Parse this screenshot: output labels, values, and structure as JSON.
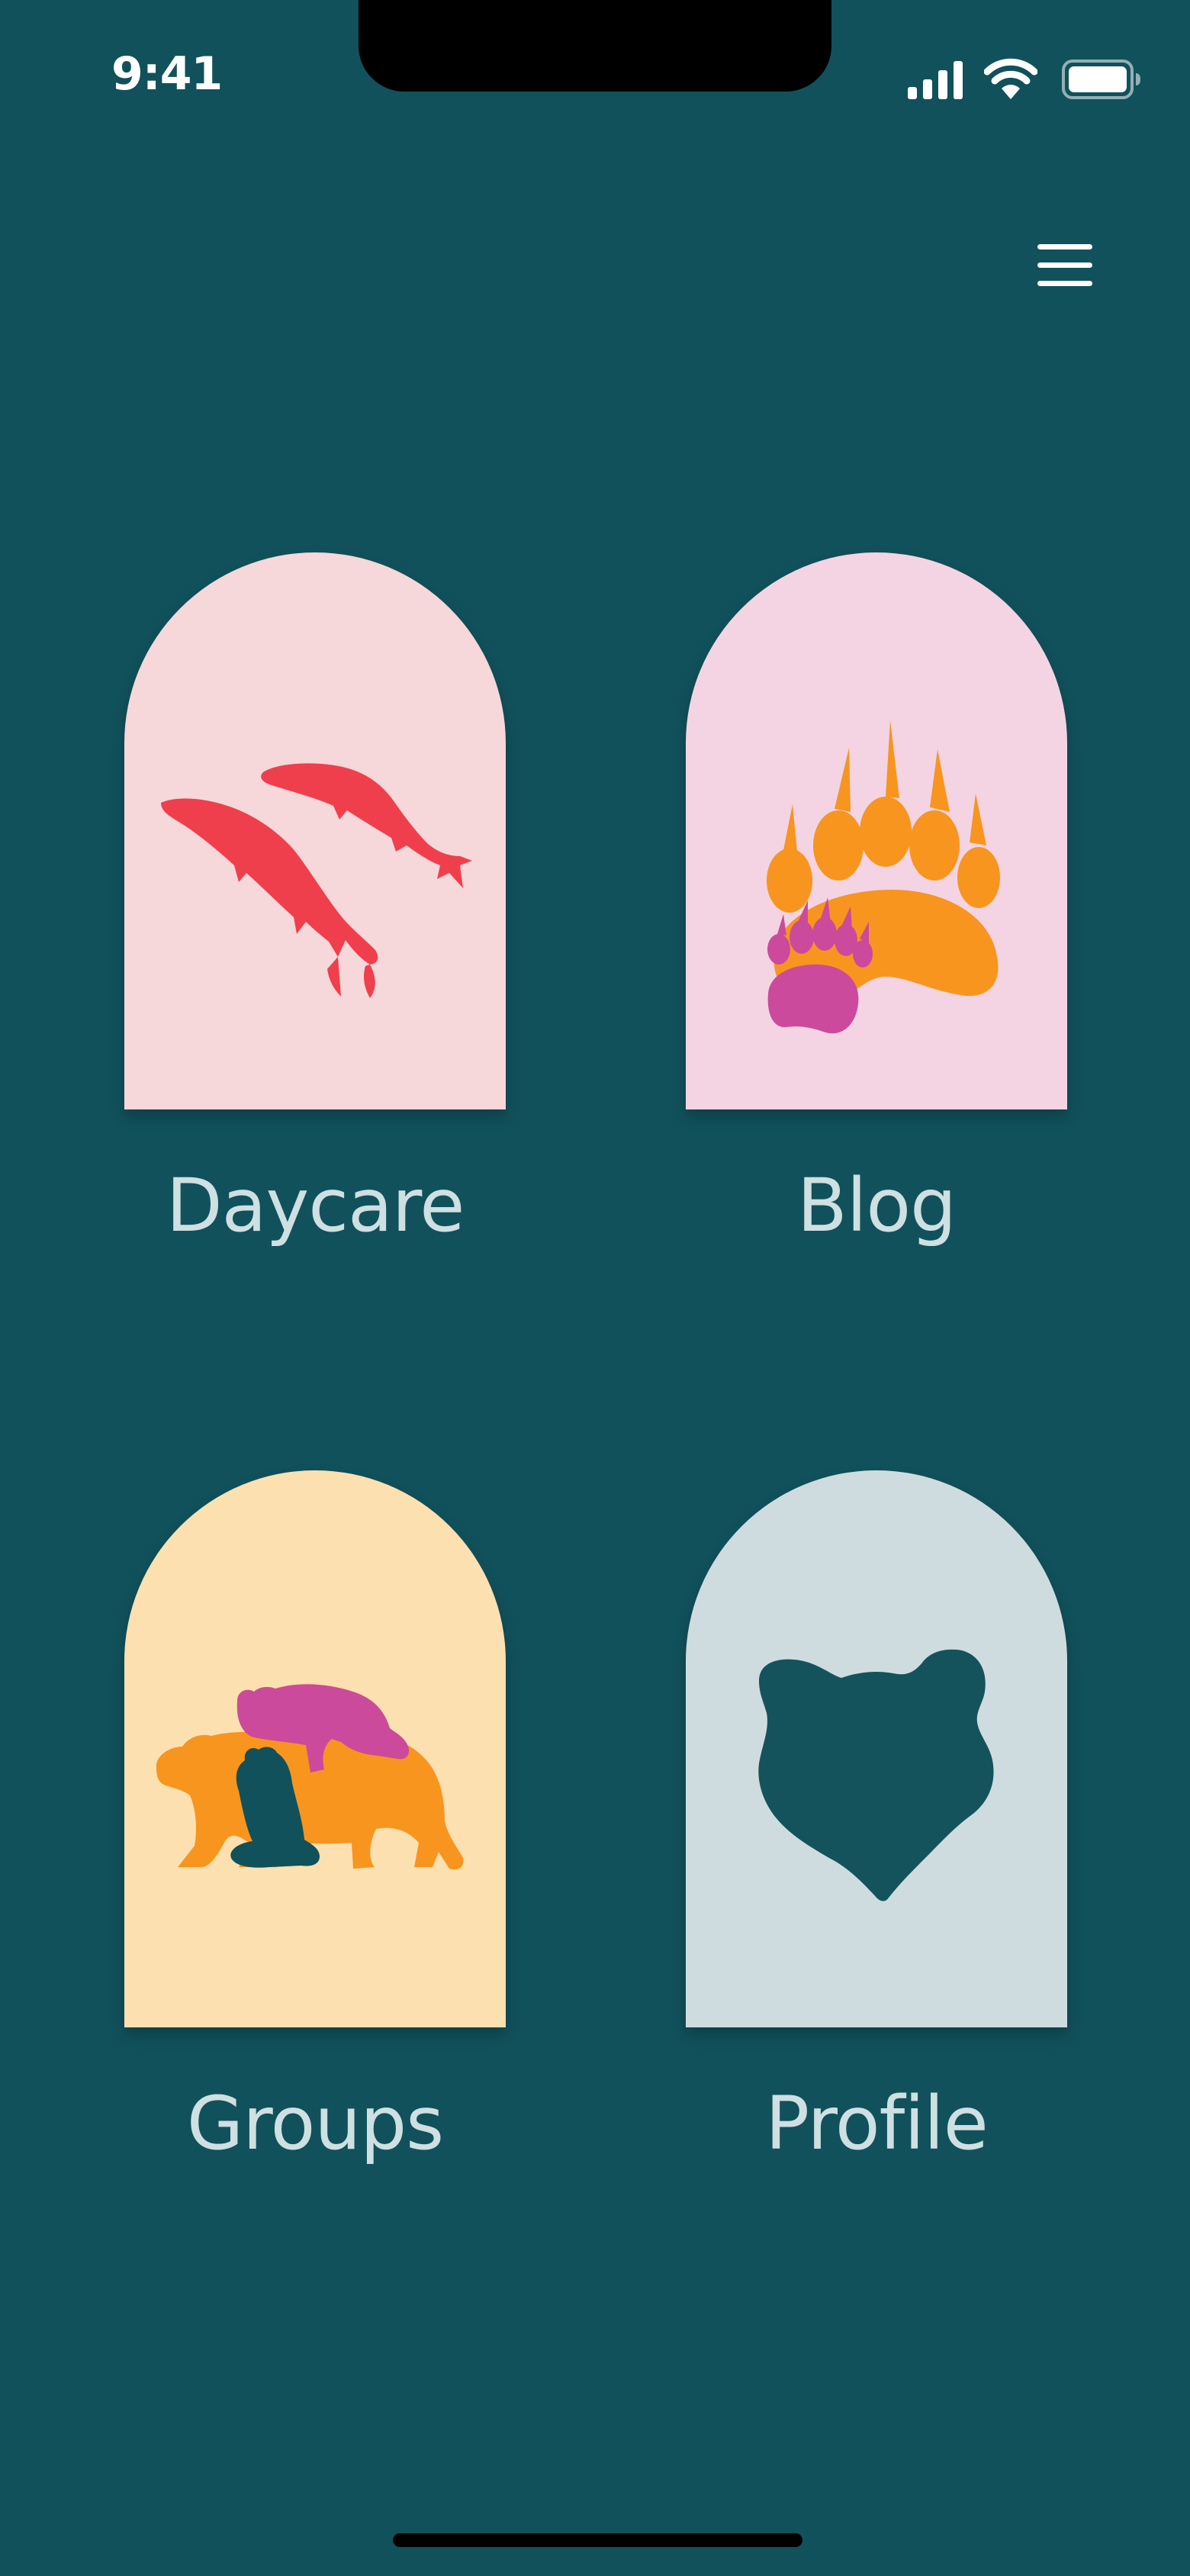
{
  "status_bar": {
    "time": "9:41",
    "icons": [
      "signal-icon",
      "wifi-icon",
      "battery-icon"
    ]
  },
  "header": {
    "menu_icon": "hamburger-menu-icon"
  },
  "tiles": [
    {
      "label": "Daycare",
      "icon": "salmon-icon",
      "bg_color": "#f6d7da",
      "icon_color": "#ef3f4c"
    },
    {
      "label": "Blog",
      "icon": "bear-paws-icon",
      "bg_color": "#f4d4e3",
      "icon_colors": [
        "#f7951f",
        "#cc4a9b"
      ]
    },
    {
      "label": "Groups",
      "icon": "bear-family-icon",
      "bg_color": "#fde0b0",
      "icon_colors": [
        "#f7951f",
        "#cc4a9b",
        "#11515b"
      ]
    },
    {
      "label": "Profile",
      "icon": "bear-head-icon",
      "bg_color": "#cfdcdf",
      "icon_color": "#14535c"
    }
  ],
  "colors": {
    "background": "#11515b",
    "label_text": "#cfe0e2"
  }
}
